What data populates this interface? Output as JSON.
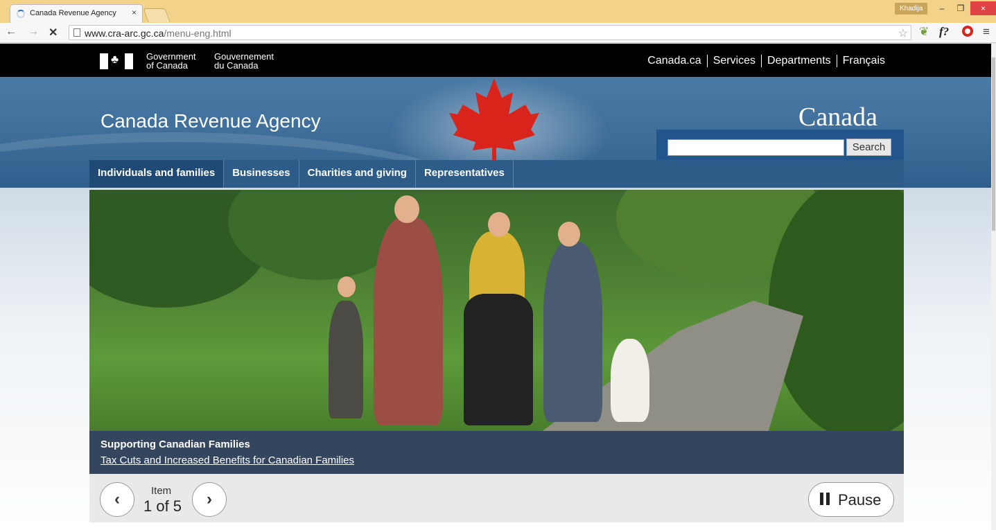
{
  "browser": {
    "tab_title": "Canada Revenue Agency",
    "tab_close": "×",
    "profile_name": "Khadija",
    "window_buttons": {
      "minimize": "–",
      "maximize": "❐",
      "close": "×"
    },
    "nav": {
      "back": "←",
      "forward": "→",
      "stop": "✕"
    },
    "url_host": "www.cra-arc.gc.ca",
    "url_path": "/menu-eng.html",
    "extensions": [
      "f?",
      "opera-icon",
      "menu-icon"
    ]
  },
  "gc_header": {
    "gov_en_line1": "Government",
    "gov_en_line2": "of Canada",
    "gov_fr_line1": "Gouvernement",
    "gov_fr_line2": "du Canada",
    "links": [
      "Canada.ca",
      "Services",
      "Departments",
      "Français"
    ]
  },
  "site": {
    "title": "Canada Revenue Agency",
    "wordmark": "Canada",
    "search_placeholder": "",
    "search_button": "Search"
  },
  "menu": {
    "items": [
      "Individuals and families",
      "Businesses",
      "Charities and giving",
      "Representatives"
    ]
  },
  "carousel": {
    "caption_title": "Supporting Canadian Families",
    "caption_link": "Tax Cuts and Increased Benefits for Canadian Families",
    "item_label": "Item",
    "item_count": "1 of 5",
    "prev": "‹",
    "next": "›",
    "pause_label": "Pause"
  }
}
